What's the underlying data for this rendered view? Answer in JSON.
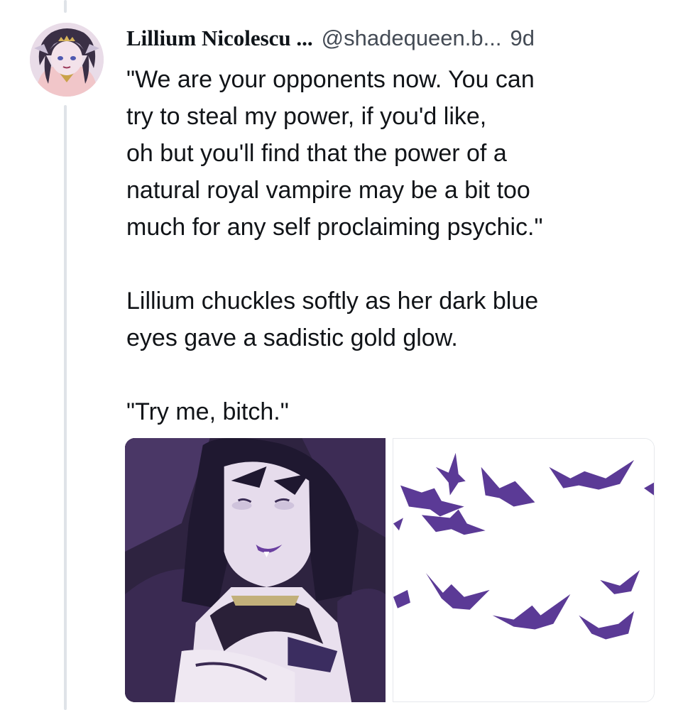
{
  "post": {
    "author": {
      "display_name": "Lillium Nicolescu ...",
      "handle": "@shadequeen.b...",
      "avatar_icon": "avatar-image"
    },
    "timestamp": "9d",
    "text_lines": [
      "\"We are your opponents now. You can",
      "try to steal my power, if you'd like,",
      "oh but you'll find that the power of a",
      "natural royal vampire may be a bit too",
      "much for any self proclaiming psychic.\""
    ],
    "paragraph_2_lines": [
      "Lillium chuckles softly as her dark blue",
      "eyes gave a sadistic gold glow."
    ],
    "paragraph_3": "\"Try me, bitch.\"",
    "media": [
      {
        "kind": "image",
        "icon": "anime-character-image"
      },
      {
        "kind": "image",
        "icon": "purple-bats-image"
      }
    ]
  },
  "colors": {
    "thread_line": "#dfe3e8",
    "text": "#111418",
    "muted": "#444b55",
    "bat_purple": "#5b3a96"
  }
}
